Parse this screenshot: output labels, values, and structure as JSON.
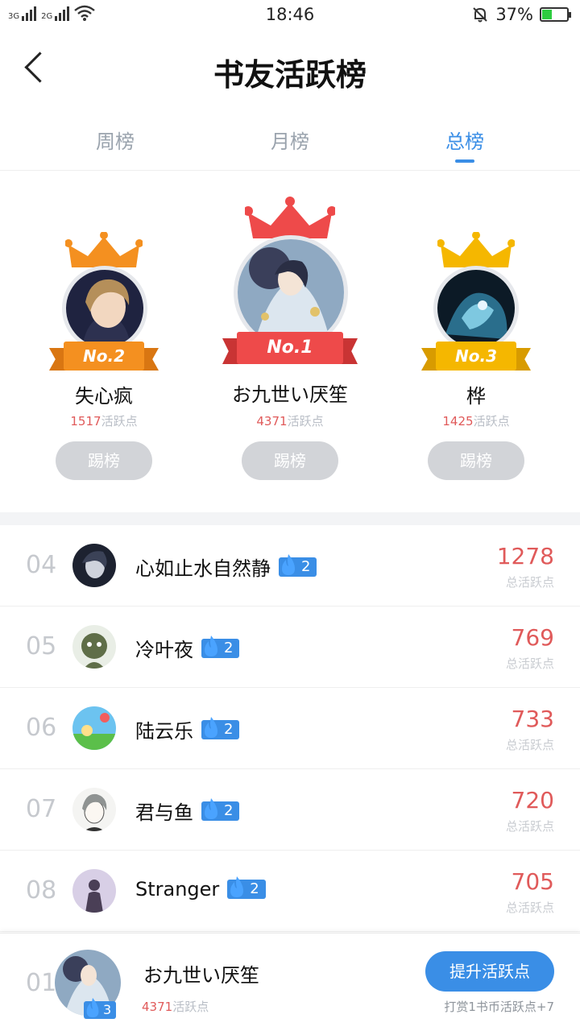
{
  "status_bar": {
    "network_1": "3G",
    "network_2": "2G",
    "time": "18:46",
    "battery": "37%",
    "battery_level": 0.37
  },
  "header": {
    "title": "书友活跃榜"
  },
  "tabs": [
    {
      "label": "周榜",
      "active": false
    },
    {
      "label": "月榜",
      "active": false
    },
    {
      "label": "总榜",
      "active": true
    }
  ],
  "podium": {
    "first": {
      "badge": "No.1",
      "name": "お九世い厌笙",
      "points": "4371",
      "points_label": "活跃点",
      "button": "踢榜",
      "color": "#ee4a4a"
    },
    "second": {
      "badge": "No.2",
      "name": "失心疯",
      "points": "1517",
      "points_label": "活跃点",
      "button": "踢榜",
      "color": "#f49020"
    },
    "third": {
      "badge": "No.3",
      "name": "桦",
      "points": "1425",
      "points_label": "活跃点",
      "button": "踢榜",
      "color": "#f5b700"
    }
  },
  "ranking": [
    {
      "rank": "04",
      "name": "心如止水自然静",
      "level": "2",
      "score": "1278",
      "score_label": "总活跃点"
    },
    {
      "rank": "05",
      "name": "冷叶夜",
      "level": "2",
      "score": "769",
      "score_label": "总活跃点"
    },
    {
      "rank": "06",
      "name": "陆云乐",
      "level": "2",
      "score": "733",
      "score_label": "总活跃点"
    },
    {
      "rank": "07",
      "name": "君与鱼",
      "level": "2",
      "score": "720",
      "score_label": "总活跃点"
    },
    {
      "rank": "08",
      "name": "Stranger",
      "level": "2",
      "score": "705",
      "score_label": "总活跃点"
    }
  ],
  "me": {
    "rank": "01",
    "name": "お九世い厌笙",
    "level": "3",
    "points": "4371",
    "points_label": "活跃点",
    "button": "提升活跃点",
    "tip": "打赏1书币活跃点+7"
  },
  "colors": {
    "accent": "#3a8ee6",
    "score_red": "#e05a5a",
    "muted": "#c6c9ce"
  }
}
